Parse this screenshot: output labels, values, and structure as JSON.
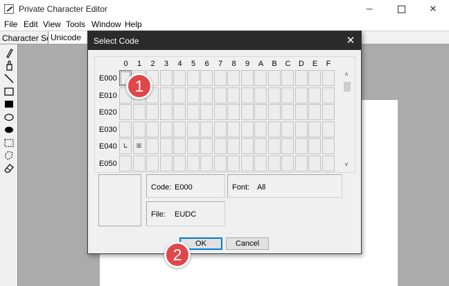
{
  "app": {
    "title": "Private Character Editor",
    "window_buttons": {
      "minimize": "─",
      "close": "✕"
    }
  },
  "menu": [
    "File",
    "Edit",
    "View",
    "Tools",
    "Window",
    "Help"
  ],
  "charset_bar": {
    "label": "Character Set:",
    "value": "Unicode"
  },
  "toolbox": [
    "pencil-icon",
    "brush-icon",
    "line-icon",
    "hollow-rectangle-icon",
    "filled-rectangle-icon",
    "hollow-ellipse-icon",
    "filled-ellipse-icon",
    "rectangular-selection-icon",
    "freeform-selection-icon",
    "eraser-icon"
  ],
  "dialog": {
    "title": "Select Code",
    "close": "✕",
    "columns": [
      "0",
      "1",
      "2",
      "3",
      "4",
      "5",
      "6",
      "7",
      "8",
      "9",
      "A",
      "B",
      "C",
      "D",
      "E",
      "F"
    ],
    "rows": [
      {
        "label": "E000",
        "cells": [
          "",
          "",
          "",
          "",
          "",
          "",
          "",
          "",
          "",
          "",
          "",
          "",
          "",
          "",
          "",
          ""
        ]
      },
      {
        "label": "E010",
        "cells": [
          "",
          "",
          "",
          "",
          "",
          "",
          "",
          "",
          "",
          "",
          "",
          "",
          "",
          "",
          "",
          ""
        ]
      },
      {
        "label": "E020",
        "cells": [
          "",
          "",
          "",
          "",
          "",
          "",
          "",
          "",
          "",
          "",
          "",
          "",
          "",
          "",
          "",
          ""
        ]
      },
      {
        "label": "E030",
        "cells": [
          "",
          "",
          "",
          "",
          "",
          "",
          "",
          "",
          "",
          "",
          "",
          "",
          "",
          "",
          "",
          ""
        ]
      },
      {
        "label": "E040",
        "cells": [
          "ᒐ",
          "ꕤ",
          "",
          "",
          "",
          "",
          "",
          "",
          "",
          "",
          "",
          "",
          "",
          "",
          "",
          ""
        ]
      },
      {
        "label": "E050",
        "cells": [
          "",
          "",
          "",
          "",
          "",
          "",
          "",
          "",
          "",
          "",
          "",
          "",
          "",
          "",
          "",
          ""
        ]
      }
    ],
    "selected": {
      "row": 0,
      "col": 0
    },
    "scroll_up": "˄",
    "scroll_down": "˅",
    "code_label": "Code:",
    "code_value": "E000",
    "font_label": "Font:",
    "font_value": "All",
    "file_label": "File:",
    "file_value": "EUDC",
    "ok_label": "OK",
    "cancel_label": "Cancel"
  },
  "annotations": {
    "badge_1": "1",
    "badge_2": "2",
    "badge_color": "#e0474c"
  }
}
